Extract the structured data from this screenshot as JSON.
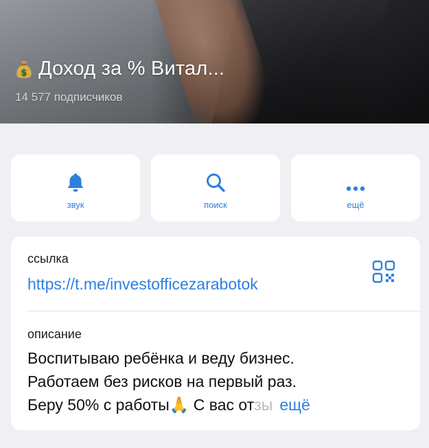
{
  "channel": {
    "title": "Доход за % Витал...",
    "subscribers": "14 577 подписчиков",
    "title_icon": "money-bag-icon"
  },
  "actions": [
    {
      "label": "звук",
      "icon": "bell-icon"
    },
    {
      "label": "поиск",
      "icon": "search-icon"
    },
    {
      "label": "ещё",
      "icon": "more-icon"
    }
  ],
  "link": {
    "caption": "ссылка",
    "url": "https://t.me/investofficezarabotok",
    "icon": "qr-code-icon"
  },
  "description": {
    "caption": "описание",
    "line1": "Воспитываю ребёнка и веду бизнес.",
    "line2": "Работаем без рисков на первый раз.",
    "line3": "Беру 50% с работы",
    "line3_emoji": "🙏",
    "line3_tail": " С вас отзы",
    "more": "ещё"
  },
  "colors": {
    "accent": "#2f7fe0",
    "background": "#f0f0f4",
    "card": "#ffffff"
  }
}
